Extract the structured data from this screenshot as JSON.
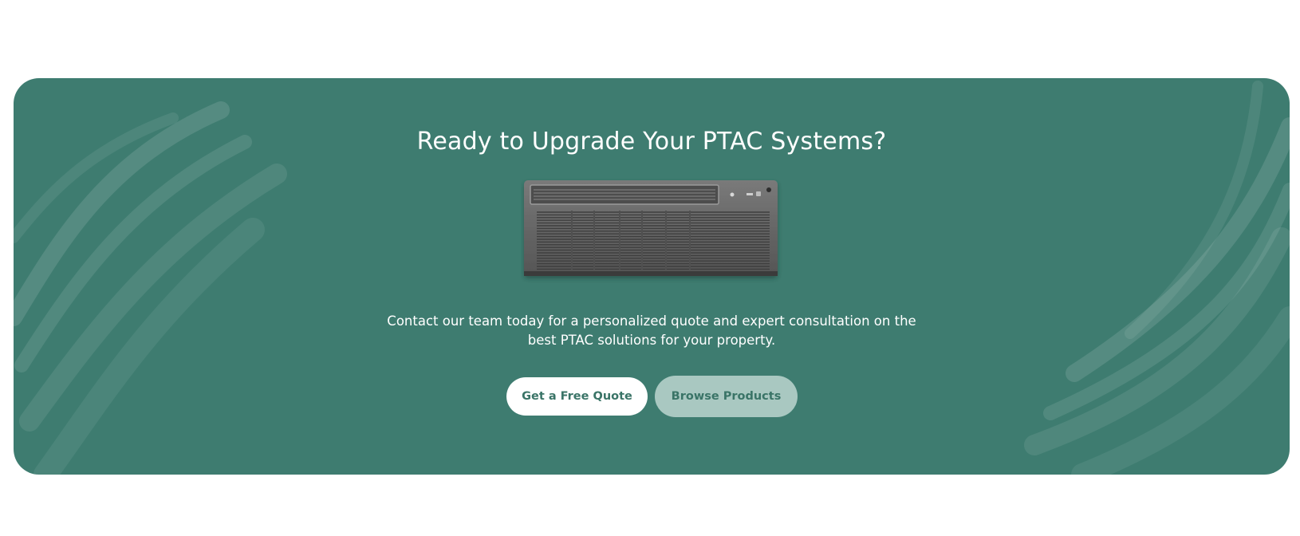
{
  "cta": {
    "title": "Ready to Upgrade Your PTAC Systems?",
    "product_image_icon": "ptac-unit-illustration",
    "description": "Contact our team today for a personalized quote and expert consultation on the best PTAC solutions for your property.",
    "primary_button": "Get a Free Quote",
    "secondary_button": "Browse Products"
  },
  "colors": {
    "banner_background": "#3e7c70",
    "primary_button_bg": "#ffffff",
    "secondary_button_bg": "#a9c8c1",
    "button_text": "#3a7467",
    "heading_text": "#ffffff"
  }
}
